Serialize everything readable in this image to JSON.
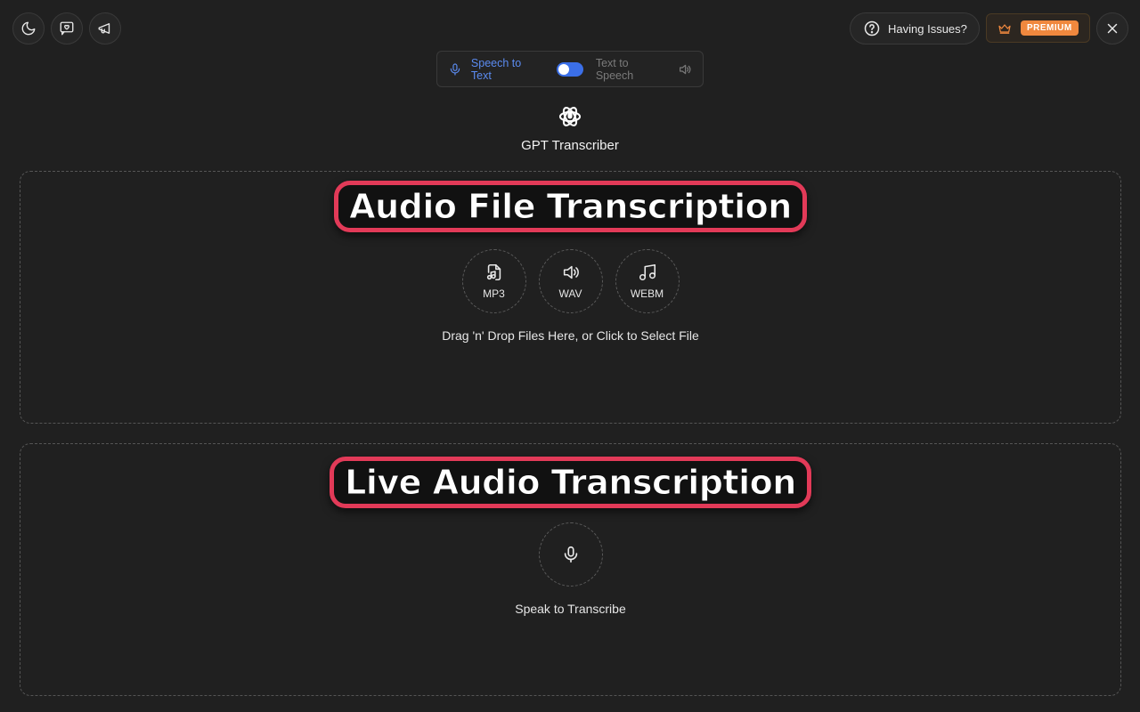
{
  "header": {
    "issues_label": "Having Issues?",
    "premium_label": "PREMIUM"
  },
  "mode_switch": {
    "speech_to_text": "Speech to Text",
    "text_to_speech": "Text to Speech",
    "accent_color": "#5b8bf0"
  },
  "brand": {
    "name": "GPT Transcriber"
  },
  "file_panel": {
    "title": "Audio File Transcription",
    "formats": [
      {
        "label": "MP3",
        "icon": "music-file-icon"
      },
      {
        "label": "WAV",
        "icon": "speaker-icon"
      },
      {
        "label": "WEBM",
        "icon": "music-note-icon"
      }
    ],
    "drop_text": "Drag 'n' Drop Files Here, or Click to Select File"
  },
  "live_panel": {
    "title": "Live Audio Transcription",
    "speak_text": "Speak to Transcribe"
  },
  "colors": {
    "background": "#202020",
    "title_border": "#e23a58",
    "premium": "#f0883e",
    "toggle": "#3b6fe8"
  }
}
